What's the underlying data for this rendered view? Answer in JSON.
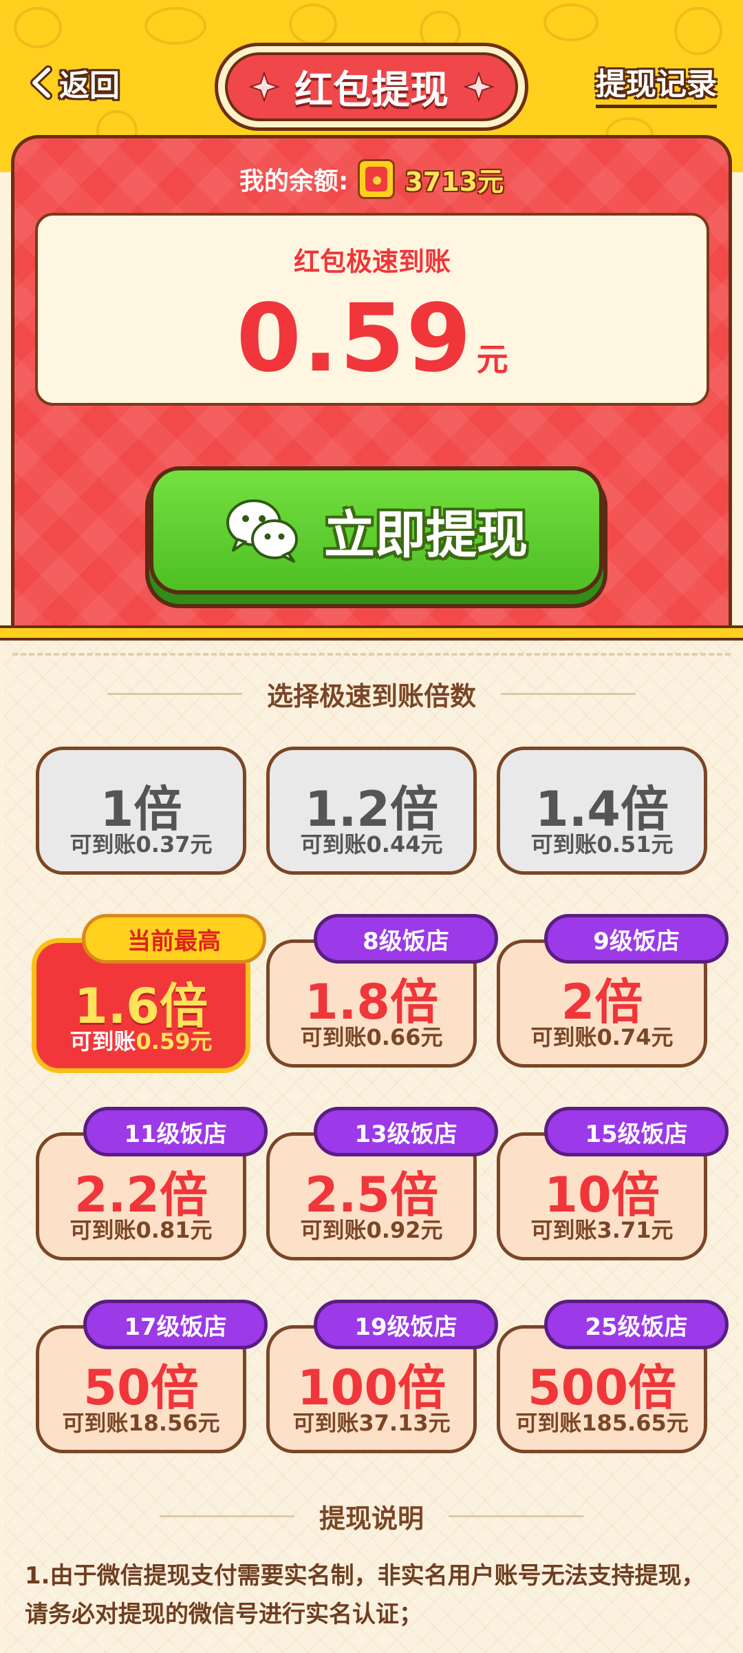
{
  "header": {
    "back_label": "返回",
    "title": "红包提现",
    "records_label": "提现记录"
  },
  "balance": {
    "label": "我的余额:",
    "value": "3713元"
  },
  "amount": {
    "title": "红包极速到账",
    "value": "0.59",
    "unit": "元"
  },
  "withdraw_button": {
    "label": "立即提现",
    "icon": "wechat-icon"
  },
  "multiplier_section": {
    "title": "选择极速到账倍数",
    "options": [
      {
        "mult": "1倍",
        "note": "可到账0.37元",
        "tag": "",
        "state": "unlocked"
      },
      {
        "mult": "1.2倍",
        "note": "可到账0.44元",
        "tag": "",
        "state": "unlocked"
      },
      {
        "mult": "1.4倍",
        "note": "可到账0.51元",
        "tag": "",
        "state": "unlocked"
      },
      {
        "mult": "1.6倍",
        "note_prefix": "可到账",
        "note_value": "0.59元",
        "tag": "当前最高",
        "state": "selected"
      },
      {
        "mult": "1.8倍",
        "note": "可到账0.66元",
        "tag": "8级饭店",
        "state": "locked"
      },
      {
        "mult": "2倍",
        "note": "可到账0.74元",
        "tag": "9级饭店",
        "state": "locked"
      },
      {
        "mult": "2.2倍",
        "note": "可到账0.81元",
        "tag": "11级饭店",
        "state": "locked"
      },
      {
        "mult": "2.5倍",
        "note": "可到账0.92元",
        "tag": "13级饭店",
        "state": "locked"
      },
      {
        "mult": "10倍",
        "note": "可到账3.71元",
        "tag": "15级饭店",
        "state": "locked"
      },
      {
        "mult": "50倍",
        "note": "可到账18.56元",
        "tag": "17级饭店",
        "state": "locked"
      },
      {
        "mult": "100倍",
        "note": "可到账37.13元",
        "tag": "19级饭店",
        "state": "locked"
      },
      {
        "mult": "500倍",
        "note": "可到账185.65元",
        "tag": "25级饭店",
        "state": "locked"
      }
    ]
  },
  "rules_section": {
    "title": "提现说明",
    "items": [
      "1.由于微信提现支付需要实名制，非实名用户账号无法支持提现，请务必对提现的微信号进行实名认证；"
    ]
  },
  "colors": {
    "header_yellow": "#ffd11e",
    "card_red": "#f24a4a",
    "button_green": "#5fcf2e",
    "tag_purple": "#9c39e8",
    "outline_brown": "#6b2f12"
  }
}
